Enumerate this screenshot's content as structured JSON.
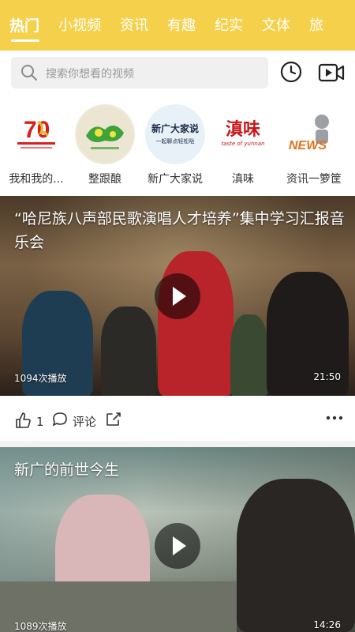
{
  "tabs": [
    "热门",
    "小视频",
    "资讯",
    "有趣",
    "纪实",
    "文体",
    "旅"
  ],
  "search": {
    "placeholder": "搜索你想看的视频"
  },
  "channels": [
    {
      "label": "我和我的..."
    },
    {
      "label": "整跟酿"
    },
    {
      "label": "新广大家说",
      "logo_text": "新广大家说",
      "logo_sub": "一起聊点轻松哒"
    },
    {
      "label": "滇味",
      "logo_text": "滇味",
      "logo_sub": "taste of yunnan"
    },
    {
      "label": "资讯一箩筐",
      "logo_text": "NEWS"
    }
  ],
  "videos": [
    {
      "title": "“哈尼族八声部民歌演唱人才培养”集中学习汇报音乐会",
      "views": "1094次播放",
      "duration": "21:50"
    },
    {
      "title": "新广的前世今生",
      "views": "1089次播放",
      "duration": "14:26"
    }
  ],
  "actions": {
    "likes": "1",
    "comment_label": "评论"
  },
  "colors": {
    "accent": "#f5d04a"
  }
}
